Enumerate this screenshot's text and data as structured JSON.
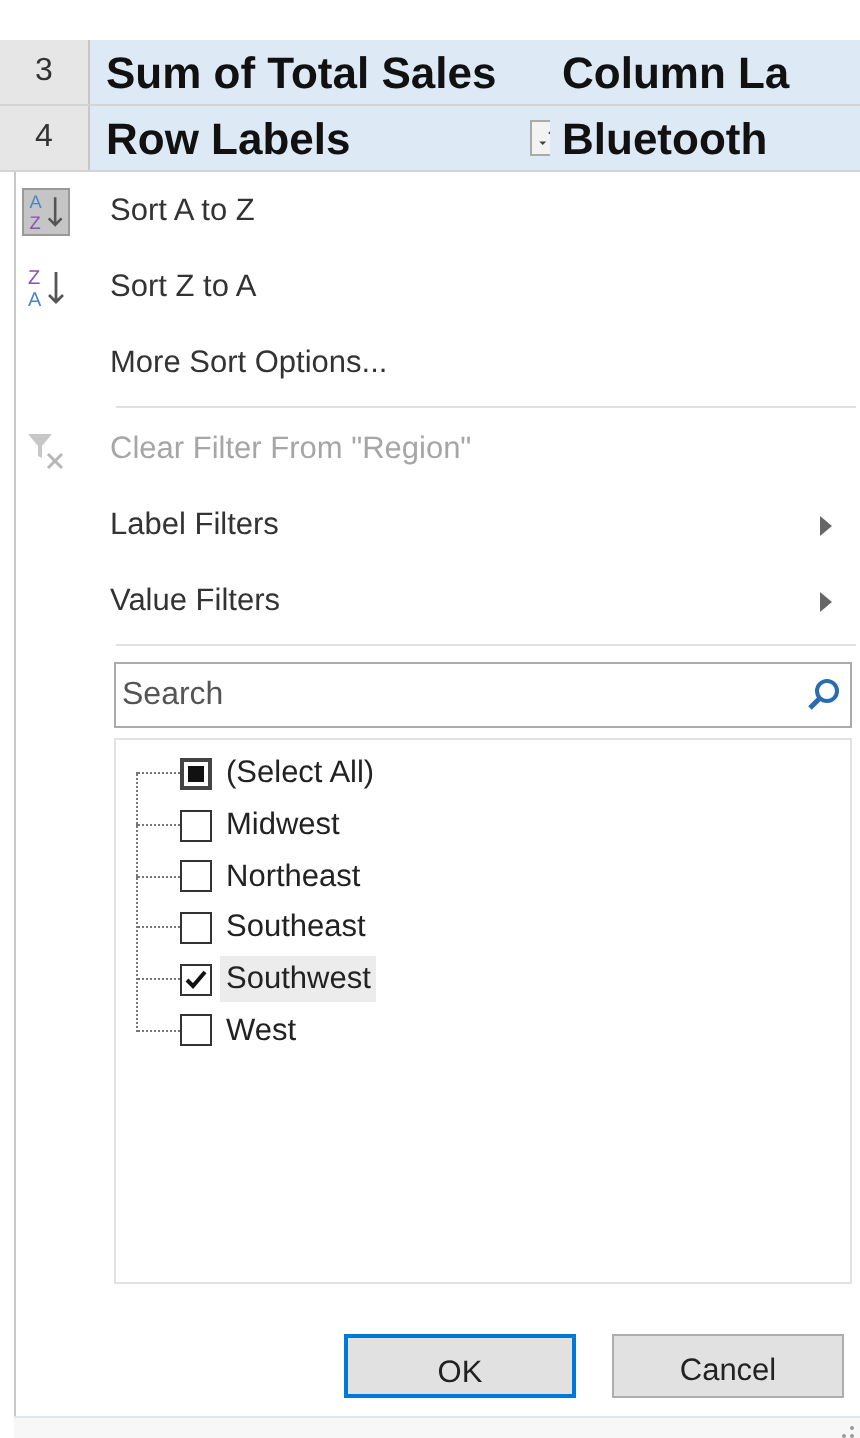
{
  "sheet_rows": [
    {
      "row_number": "3",
      "cells": [
        "Sum of Total Sales",
        "Column La"
      ],
      "filter_button": false
    },
    {
      "row_number": "4",
      "cells": [
        "Row Labels",
        "Bluetooth"
      ],
      "filter_button": true
    }
  ],
  "menu": {
    "items": [
      {
        "kind": "sort-asc",
        "label": "Sort A to Z",
        "disabled": false,
        "highlighted_icon": true,
        "icon_letters": [
          "A",
          "Z"
        ]
      },
      {
        "kind": "sort-desc",
        "label": "Sort Z to A",
        "disabled": false,
        "highlighted_icon": false,
        "icon_letters": [
          "Z",
          "A"
        ]
      },
      {
        "kind": "plain",
        "label": "More Sort Options...",
        "disabled": false
      },
      {
        "kind": "separator"
      },
      {
        "kind": "clear-filter",
        "label": "Clear Filter From \"Region\"",
        "disabled": true,
        "highlighted_icon": false
      },
      {
        "kind": "submenu",
        "label": "Label Filters",
        "disabled": false
      },
      {
        "kind": "submenu",
        "label": "Value Filters",
        "disabled": false
      },
      {
        "kind": "separator"
      }
    ],
    "search": {
      "placeholder": "Search"
    },
    "values": [
      {
        "kind": "select-all",
        "label": "(Select All)",
        "checked": false,
        "partial": true,
        "selected": false
      },
      {
        "kind": "value",
        "label": "Midwest",
        "checked": false,
        "selected": false
      },
      {
        "kind": "value",
        "label": "Northeast",
        "checked": false,
        "selected": false
      },
      {
        "kind": "value",
        "label": "Southeast",
        "checked": false,
        "selected": false
      },
      {
        "kind": "value",
        "label": "Southwest",
        "checked": true,
        "selected": true
      },
      {
        "kind": "value",
        "label": "West",
        "checked": false,
        "selected": false
      }
    ],
    "buttons": [
      {
        "label": "OK",
        "default": true
      },
      {
        "label": "Cancel",
        "default": false
      }
    ]
  }
}
